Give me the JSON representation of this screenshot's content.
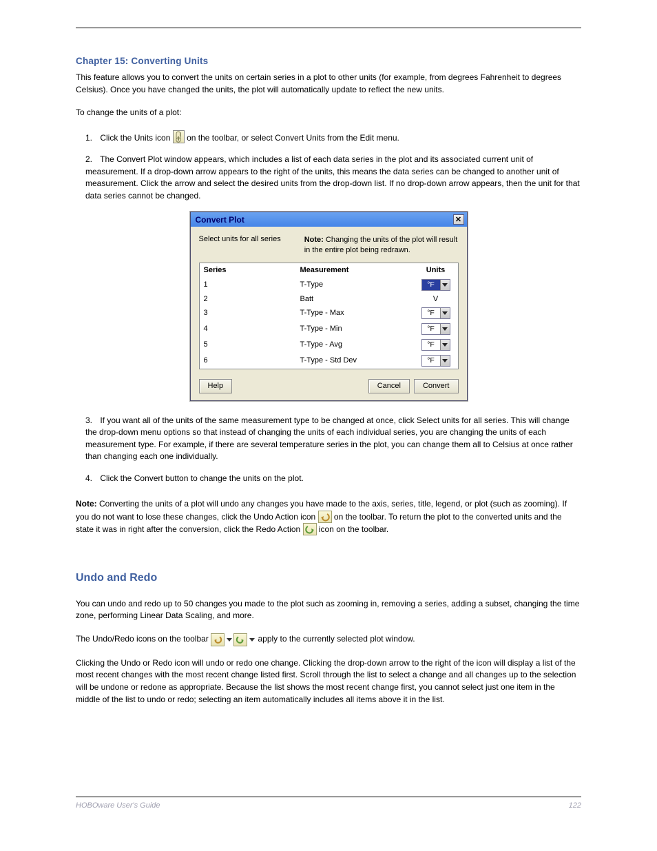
{
  "chapter_label": "Chapter 15: Converting Units",
  "intro": "This feature allows you to convert the units on certain series in a plot to other units (for example, from degrees Fahrenheit to degrees Celsius). Once you have changed the units, the plot will automatically update to reflect the new units.",
  "steps_title": "To change the units of a plot:",
  "steps": [
    {
      "num": "1.",
      "pre": "Click the Units icon ",
      "post": " on the toolbar, or select Convert Units from the Edit menu."
    },
    {
      "num": "2.",
      "text": "The Convert Plot window appears, which includes a list of each data series in the plot and its associated current unit of measurement. If a drop-down arrow appears to the right of the units, this means the data series can be changed to another unit of measurement. Click the arrow and select the desired units from the drop-down list. If no drop-down arrow appears, then the unit for that data series cannot be changed."
    }
  ],
  "dialog": {
    "title": "Convert Plot",
    "select_label": "Select units for all series",
    "note": "Note: Changing the units of the plot will result in the entire plot being redrawn.",
    "columns": {
      "series": "Series",
      "measurement": "Measurement",
      "units": "Units"
    },
    "rows": [
      {
        "series": "1",
        "measurement": "T-Type",
        "units": "°F",
        "dd": true,
        "selected": true
      },
      {
        "series": "2",
        "measurement": "Batt",
        "units": "V",
        "dd": false,
        "selected": false
      },
      {
        "series": "3",
        "measurement": "T-Type - Max",
        "units": "°F",
        "dd": true,
        "selected": false
      },
      {
        "series": "4",
        "measurement": "T-Type - Min",
        "units": "°F",
        "dd": true,
        "selected": false
      },
      {
        "series": "5",
        "measurement": "T-Type - Avg",
        "units": "°F",
        "dd": true,
        "selected": false
      },
      {
        "series": "6",
        "measurement": "T-Type - Std Dev",
        "units": "°F",
        "dd": true,
        "selected": false
      }
    ],
    "buttons": {
      "help": "Help",
      "cancel": "Cancel",
      "convert": "Convert"
    }
  },
  "post_dialog": [
    "If you want all of the units of the same measurement type to be changed at once, click Select units for all series. This will change the drop-down menu options so that instead of changing the units of each individual series, you are changing the units of each measurement type. For example, if there are several temperature series in the plot, you can change them all to Celsius at once rather than changing each one individually.",
    "Click the Convert button to change the units on the plot."
  ],
  "post_dialog_nums": [
    "3.",
    "4."
  ],
  "note_para": {
    "note_label": "Note:",
    "note_body": " Converting the units of a plot will undo any changes you have made to the axis, series, title, legend, or plot (such as zooming). If you do not want to lose these changes, click the Undo Action icon ",
    "note_mid": " on the toolbar. To return the plot to the converted units and the state it was in right after the conversion, click the Redo Action ",
    "note_end": " icon on the toolbar."
  },
  "undo_section": {
    "heading": "Undo and Redo",
    "p1": "You can undo and redo up to 50 changes you made to the plot such as zooming in, removing a series, adding a subset, changing the time zone, performing Linear Data Scaling, and more.",
    "p2_pre": "The Undo/Redo icons on the toolbar ",
    "p2_post": " apply to the currently selected plot window.",
    "p3": "Clicking the Undo or Redo icon will undo or redo one change. Clicking the drop-down arrow to the right of the icon will display a list of the most recent changes with the most recent change listed first. Scroll through the list to select a change and all changes up to the selection will be undone or redone as appropriate. Because the list shows the most recent change first, you cannot select just one item in the middle of the list to undo or redo; selecting an item automatically includes all items above it in the list."
  },
  "footer": {
    "left": "HOBOware User's Guide",
    "right": "122"
  }
}
